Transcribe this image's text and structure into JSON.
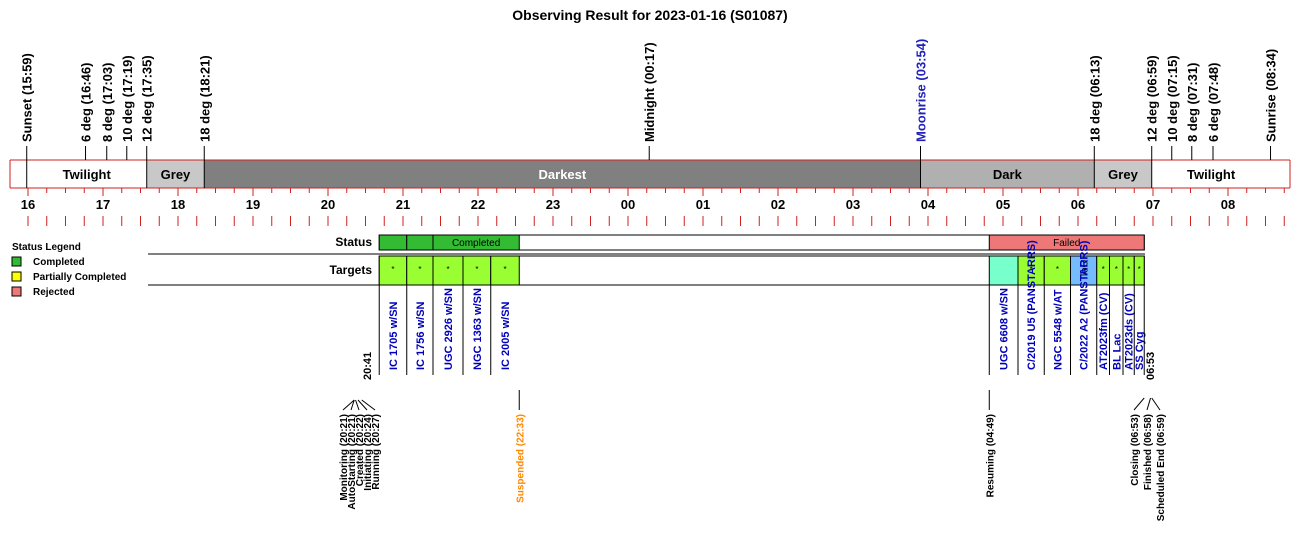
{
  "title": "Observing Result for 2023-01-16 (S01087)",
  "colors": {
    "axis": "#d02020",
    "twilight": "#ffffff",
    "grey": "#c8c8c8",
    "darkest": "#808080",
    "dark": "#b0b0b0",
    "completed": "#33bb33",
    "failed": "#ee7777",
    "target": "#99ff33",
    "resuming": "#77ffcc",
    "too": "#77bbff",
    "target_label": "#0000bb",
    "moon_label": "#2222bb",
    "suspended_label": "#ff8800"
  },
  "sun_events": [
    {
      "label": "Sunset (15:59)",
      "t": 15.983,
      "color": "#000000"
    },
    {
      "label": "6 deg (16:46)",
      "t": 16.767,
      "color": "#000000"
    },
    {
      "label": "8 deg (17:03)",
      "t": 17.05,
      "color": "#000000"
    },
    {
      "label": "10 deg (17:19)",
      "t": 17.317,
      "color": "#000000"
    },
    {
      "label": "12 deg (17:35)",
      "t": 17.583,
      "color": "#000000"
    },
    {
      "label": "18 deg (18:21)",
      "t": 18.35,
      "color": "#000000"
    },
    {
      "label": "Midnight (00:17)",
      "t": 24.283,
      "color": "#000000"
    },
    {
      "label": "Moonrise (03:54)",
      "t": 27.9,
      "color": "#2222bb"
    },
    {
      "label": "18 deg (06:13)",
      "t": 30.217,
      "color": "#000000"
    },
    {
      "label": "12 deg (06:59)",
      "t": 30.983,
      "color": "#000000"
    },
    {
      "label": "10 deg (07:15)",
      "t": 31.25,
      "color": "#000000"
    },
    {
      "label": "8 deg (07:31)",
      "t": 31.517,
      "color": "#000000"
    },
    {
      "label": "6 deg (07:48)",
      "t": 31.8,
      "color": "#000000"
    },
    {
      "label": "Sunrise (08:34)",
      "t": 32.567,
      "color": "#000000"
    }
  ],
  "sky_segments": [
    {
      "label": "Twilight",
      "from": 15.983,
      "to": 17.583,
      "kind": "twilight"
    },
    {
      "label": "Grey",
      "from": 17.583,
      "to": 18.35,
      "kind": "grey"
    },
    {
      "label": "Darkest",
      "from": 18.35,
      "to": 27.9,
      "kind": "darkest"
    },
    {
      "label": "Dark",
      "from": 27.9,
      "to": 30.217,
      "kind": "dark"
    },
    {
      "label": "Grey",
      "from": 30.217,
      "to": 30.983,
      "kind": "grey"
    },
    {
      "label": "Twilight",
      "from": 30.983,
      "to": 32.567,
      "kind": "twilight"
    }
  ],
  "hour_ticks": [
    {
      "label": "16",
      "t": 16
    },
    {
      "label": "17",
      "t": 17
    },
    {
      "label": "18",
      "t": 18
    },
    {
      "label": "19",
      "t": 19
    },
    {
      "label": "20",
      "t": 20
    },
    {
      "label": "21",
      "t": 21
    },
    {
      "label": "22",
      "t": 22
    },
    {
      "label": "23",
      "t": 23
    },
    {
      "label": "00",
      "t": 24
    },
    {
      "label": "01",
      "t": 25
    },
    {
      "label": "02",
      "t": 26
    },
    {
      "label": "03",
      "t": 27
    },
    {
      "label": "04",
      "t": 28
    },
    {
      "label": "05",
      "t": 29
    },
    {
      "label": "06",
      "t": 30
    },
    {
      "label": "07",
      "t": 31
    },
    {
      "label": "08",
      "t": 32
    }
  ],
  "legend": {
    "title": "Status Legend",
    "items": [
      {
        "label": "Completed",
        "color": "#33bb33"
      },
      {
        "label": "Partially Completed",
        "color": "#ffff00"
      },
      {
        "label": "Rejected",
        "color": "#ee7777"
      }
    ]
  },
  "rows": {
    "status": "Status",
    "targets": "Targets"
  },
  "status_blocks": [
    {
      "from": 20.683,
      "to": 21.05,
      "label": "",
      "kind": "completed"
    },
    {
      "from": 21.05,
      "to": 21.4,
      "label": "",
      "kind": "completed"
    },
    {
      "from": 21.4,
      "to": 22.55,
      "label": "Completed",
      "kind": "completed"
    },
    {
      "from": 28.817,
      "to": 30.883,
      "label": "Failed",
      "kind": "failed"
    }
  ],
  "targets": [
    {
      "name": "IC 1705 w/SN",
      "mark": "*",
      "from": 20.683,
      "to": 21.05,
      "kind": "target"
    },
    {
      "name": "IC 1756 w/SN",
      "mark": "*",
      "from": 21.05,
      "to": 21.4,
      "kind": "target"
    },
    {
      "name": "UGC 2926 w/SN",
      "mark": "*",
      "from": 21.4,
      "to": 21.8,
      "kind": "target"
    },
    {
      "name": "NGC 1363 w/SN",
      "mark": "*",
      "from": 21.8,
      "to": 22.17,
      "kind": "target"
    },
    {
      "name": "IC 2005 w/SN",
      "mark": "*",
      "from": 22.17,
      "to": 22.55,
      "kind": "target"
    },
    {
      "name": "UGC 6608 w/SN",
      "mark": "",
      "from": 28.817,
      "to": 29.2,
      "kind": "resuming"
    },
    {
      "name": "C/2019 U5 (PANSTARRS)",
      "mark": "*",
      "from": 29.2,
      "to": 29.55,
      "kind": "target"
    },
    {
      "name": "NGC 5548 w/AT",
      "mark": "*",
      "from": 29.55,
      "to": 29.9,
      "kind": "target"
    },
    {
      "name": "C/2022 A2 (PANSTARRS)",
      "mark": "ToO",
      "from": 29.9,
      "to": 30.25,
      "kind": "too"
    },
    {
      "name": "AT2023fm (CV)",
      "mark": "*",
      "from": 30.25,
      "to": 30.42,
      "kind": "target"
    },
    {
      "name": "BL Lac",
      "mark": "*",
      "from": 30.42,
      "to": 30.6,
      "kind": "target"
    },
    {
      "name": "AT2023ds (CV)",
      "mark": "*",
      "from": 30.6,
      "to": 30.75,
      "kind": "target"
    },
    {
      "name": "SS Cyg",
      "mark": "*",
      "from": 30.75,
      "to": 30.883,
      "kind": "target"
    }
  ],
  "time_marks": [
    {
      "label": "20:41",
      "t": 20.683
    },
    {
      "label": "06:53",
      "t": 30.883
    }
  ],
  "events": [
    {
      "label": "Monitoring (20:21)",
      "t": 20.35,
      "color": "#000000"
    },
    {
      "label": "AutoStarting (20:21)",
      "t": 20.35,
      "color": "#000000"
    },
    {
      "label": "Created (20:22)",
      "t": 20.367,
      "color": "#000000"
    },
    {
      "label": "Initiating (20:24)",
      "t": 20.4,
      "color": "#000000"
    },
    {
      "label": "Running (20:27)",
      "t": 20.45,
      "color": "#000000"
    },
    {
      "label": "Suspended (22:33)",
      "t": 22.55,
      "color": "#ff8800"
    },
    {
      "label": "Resuming (04:49)",
      "t": 28.817,
      "color": "#000000"
    },
    {
      "label": "Closing (06:53)",
      "t": 30.883,
      "color": "#000000"
    },
    {
      "label": "Finished (06:58)",
      "t": 30.967,
      "color": "#000000"
    },
    {
      "label": "Scheduled End (06:59)",
      "t": 30.983,
      "color": "#000000"
    }
  ]
}
